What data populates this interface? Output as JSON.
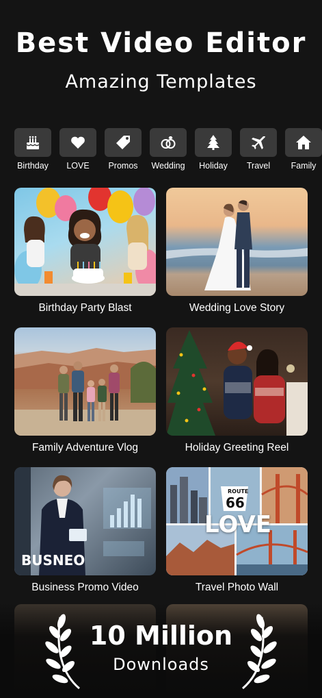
{
  "header": {
    "title": "Best Video Editor",
    "subtitle": "Amazing Templates"
  },
  "categories": [
    {
      "label": "Birthday",
      "icon": "birthday-cake-icon"
    },
    {
      "label": "LOVE",
      "icon": "heart-icon"
    },
    {
      "label": "Promos",
      "icon": "tag-icon"
    },
    {
      "label": "Wedding",
      "icon": "rings-icon"
    },
    {
      "label": "Holiday",
      "icon": "tree-icon"
    },
    {
      "label": "Travel",
      "icon": "airplane-icon"
    },
    {
      "label": "Family",
      "icon": "house-icon"
    }
  ],
  "templates": [
    {
      "label": "Birthday Party Blast"
    },
    {
      "label": "Wedding Love Story"
    },
    {
      "label": "Family Adventure Vlog"
    },
    {
      "label": "Holiday Greeting Reel"
    },
    {
      "label": "Business Promo Video",
      "overlay": "BUSNEO"
    },
    {
      "label": "Travel Photo Wall",
      "overlay": "LOVE",
      "sign_text": "ROUTE",
      "sign_number": "66"
    }
  ],
  "promo": {
    "count": "10 Million",
    "label": "Downloads"
  },
  "colors": {
    "background": "#141414",
    "category_button": "#3a3a3a",
    "text": "#ffffff"
  }
}
